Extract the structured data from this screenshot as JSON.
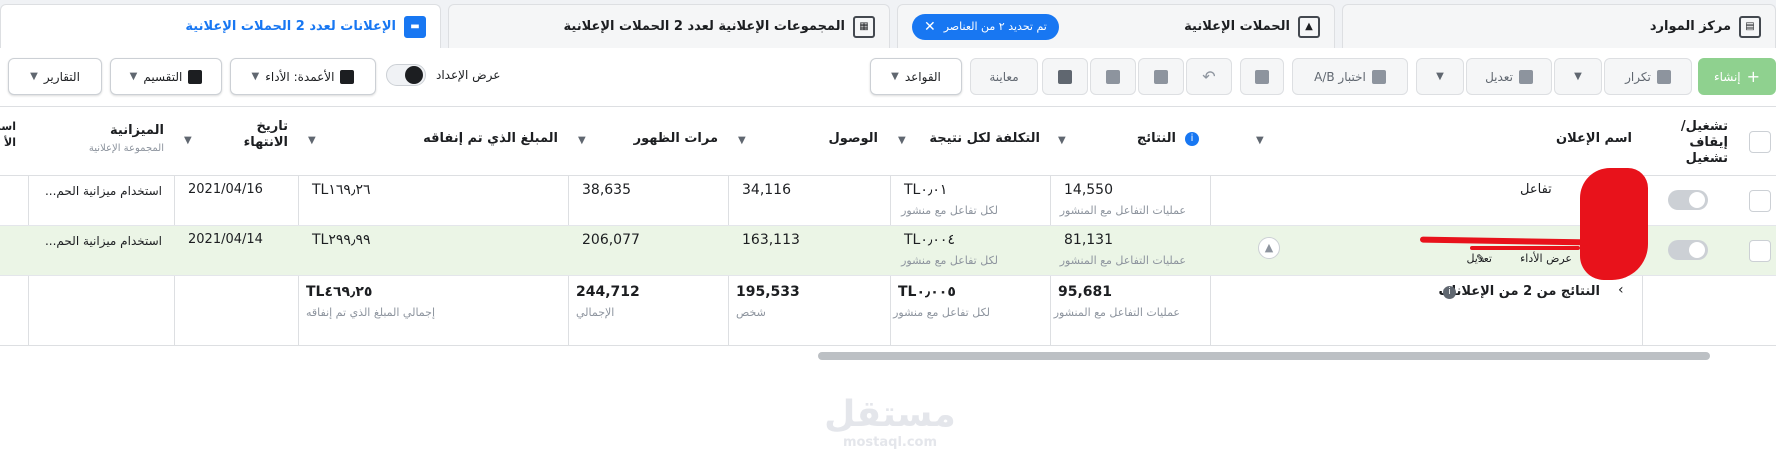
{
  "tabs": [
    {
      "label": "مركز الموارد",
      "icon": "resource-icon"
    },
    {
      "label": "الحملات الإعلانية",
      "icon": "folder-icon",
      "pill": "تم تحديد ٢ من العناصر"
    },
    {
      "label": "المجموعات الإعلانية لعدد 2 الحملات الإعلانية",
      "icon": "grid-icon"
    },
    {
      "label": "الإعلانات لعدد 2 الحملات الإعلانية",
      "icon": "ad-icon"
    }
  ],
  "toolbar": {
    "create": "إنشاء",
    "duplicate": "تكرار",
    "edit": "تعديل",
    "ab_test": "اختبار A/B",
    "rules": "القواعد",
    "preview": "معاينة",
    "view_setup": "عرض الإعداد",
    "columns": "الأعمدة: الأداء",
    "breakdown": "التقسيم",
    "reports": "التقارير"
  },
  "columns": {
    "toggle": "تشغيل/ إيقاف تشغيل",
    "ad_name": "اسم الإعلان",
    "results": "النتائج",
    "cost_per_result": "التكلفة لكل نتيجة",
    "reach": "الوصول",
    "impressions": "مرات الظهور",
    "amount_spent": "المبلغ الذي تم إنفاقه",
    "end_date": "تاريخ الانتهاء",
    "budget": "الميزانية",
    "budget_sub": "المجموعة الإعلانية",
    "extra": "است الأ"
  },
  "rows": [
    {
      "name": "تفاعل",
      "results": "14,550",
      "results_sub": "عمليات التفاعل مع المنشور",
      "cost": "TL٠٫٠١",
      "cost_sub": "لكل تفاعل مع منشور",
      "reach": "34,116",
      "impressions": "38,635",
      "spent": "TL١٦٩٫٢٦",
      "end_date": "2021/04/16",
      "budget": "استخدام ميزانية الحم..."
    },
    {
      "name": "",
      "results": "81,131",
      "results_sub": "عمليات التفاعل مع المنشور",
      "cost": "TL٠٫٠٠٤",
      "cost_sub": "لكل تفاعل مع منشور",
      "reach": "163,113",
      "impressions": "206,077",
      "spent": "TL٢٩٩٫٩٩",
      "end_date": "2021/04/14",
      "budget": "استخدام ميزانية الحم...",
      "view_perf": "عرض الأداء",
      "edit": "تعديل"
    }
  ],
  "totals": {
    "label": "النتائج من 2 من الإعلانات",
    "results": "95,681",
    "results_sub": "عمليات التفاعل مع المنشور",
    "cost": "TL٠٫٠٠٥",
    "cost_sub": "لكل تفاعل مع منشور",
    "reach": "195,533",
    "reach_sub": "شخص",
    "impressions": "244,712",
    "impressions_sub": "الإجمالي",
    "spent": "TL٤٦٩٫٢٥",
    "spent_sub": "إجمالي المبلغ الذي تم إنفاقه"
  },
  "watermark": {
    "ar": "مستقل",
    "en": "mostaql.com"
  },
  "colors": {
    "accent": "#1877f2",
    "create": "#8fd18f",
    "selected_row": "#ebf5e6",
    "redaction": "#e8121b"
  }
}
